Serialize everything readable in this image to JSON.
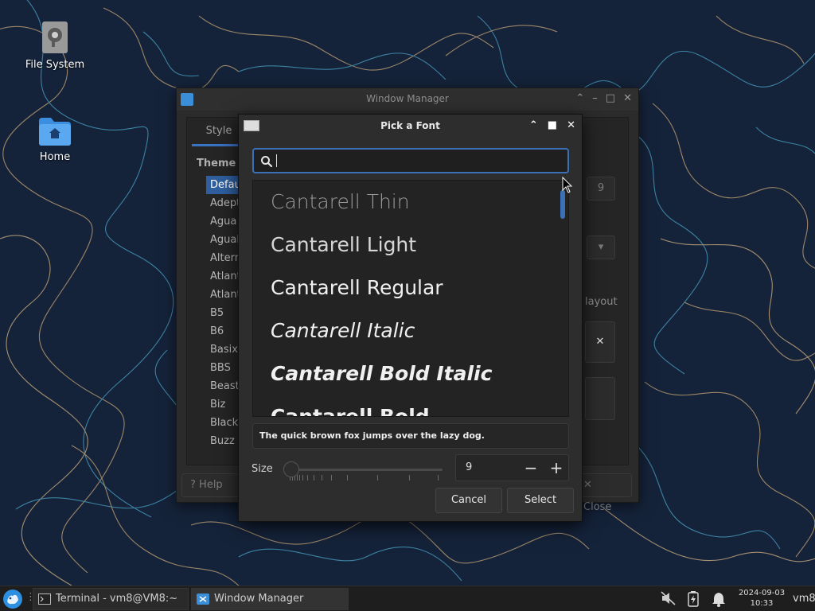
{
  "desktop": {
    "icons": [
      {
        "label": "File System",
        "icon": "drive-icon"
      },
      {
        "label": "Home",
        "icon": "home-folder-icon"
      }
    ]
  },
  "wm_window": {
    "title": "Window Manager",
    "tab_label": "Style",
    "theme_label": "Theme",
    "themes": [
      "Default",
      "Adept",
      "Agua",
      "Aguale",
      "Altern",
      "Atlant",
      "Atlant",
      "B5",
      "B6",
      "Basix",
      "BBS",
      "Beasti",
      "Biz",
      "Blackw",
      "Buzz"
    ],
    "right_value": "9",
    "right_text": "layout",
    "help_label": "Help",
    "close_label": "Close"
  },
  "font_dialog": {
    "title": "Pick a Font",
    "search": {
      "value": "",
      "placeholder": ""
    },
    "fonts": [
      {
        "name": "Cantarell Thin",
        "style": "thin"
      },
      {
        "name": "Cantarell Light",
        "style": "light"
      },
      {
        "name": "Cantarell Regular",
        "style": "regular"
      },
      {
        "name": "Cantarell Italic",
        "style": "italic"
      },
      {
        "name": "Cantarell Bold Italic",
        "style": "bolditalic"
      },
      {
        "name": "Cantarell Bold",
        "style": "bold"
      }
    ],
    "preview_text": "The quick brown fox jumps over the lazy dog.",
    "size_label": "Size",
    "size_value": "9",
    "size_fraction": 0.0,
    "minus_label": "−",
    "plus_label": "+",
    "cancel_label": "Cancel",
    "select_label": "Select"
  },
  "taskbar": {
    "tasks": [
      {
        "label": "Terminal - vm8@VM8:~",
        "icon": "terminal-icon"
      },
      {
        "label": "Window Manager",
        "icon": "window-manager-icon"
      }
    ],
    "clock_date": "2024-09-03",
    "clock_time": "10:33",
    "user": "vm8"
  },
  "colors": {
    "accent": "#3b6fb6",
    "selection": "#2f5f9e",
    "desktop_bg": "#15233a"
  }
}
